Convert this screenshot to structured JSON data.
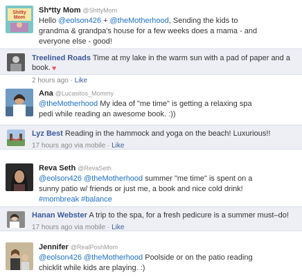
{
  "posts": [
    {
      "name": "Sh*tty Mom",
      "handle": "@ShttyMom",
      "line1_pre": "Hello ",
      "m1": "@eolson426",
      "plus": " + ",
      "m2": "@theMotherhood",
      "line1_post": ", Sending the kids to",
      "line2": "grandma & grandpa's house for a few weeks does a mama - and",
      "line3": "everyone else - good!",
      "avatar_caption": "Shitty Mom"
    },
    {
      "name": "Treelined Roads",
      "text": " Time at my lake in the warm sun with a pad of paper and a book.",
      "time": "2 hours ago",
      "sep": " · ",
      "like": "Like"
    },
    {
      "name": "Ana",
      "handle": "@Lucasitos_Mommy",
      "mention": "@theMotherhood",
      "line1_post": " My idea of \"me time\" is getting a relaxing spa",
      "line2": "pedi while reading an awesome book. :))"
    },
    {
      "name": "Lyz Best",
      "text": " Reading in the hammock and yoga on the beach! Luxurious!!",
      "time": "17 hours ago via mobile",
      "sep": " · ",
      "like": "Like"
    },
    {
      "name": "Reva Seth",
      "handle": "@RevaSeth",
      "m1": "@eolson426",
      "m2": "@theMotherhood",
      "line1_post": " summer \"me time\" is  spent on a",
      "line2": "sunny patio w/ friends or just me, a book and nice cold drink!",
      "h1": "#mombreak",
      "h2": "#balance"
    },
    {
      "name": "Hanan Webster",
      "text": " A trip to the spa, for a fresh pedicure is a summer must–do!",
      "time": "17 hours ago via mobile",
      "sep": " · ",
      "like": "Like"
    },
    {
      "name": "Jennifer",
      "handle": "@RealPoshMom",
      "m1": "@eolson426",
      "m2": "@theMotherhood",
      "line1_post": " Poolside or on the patio reading",
      "line2": "chicklit while kids are playing. :)"
    }
  ],
  "colors": {
    "link": "#1d6fc7",
    "fb_name": "#3b5998",
    "fb_bg": "#edeff4",
    "heart": "#e85a6a"
  }
}
